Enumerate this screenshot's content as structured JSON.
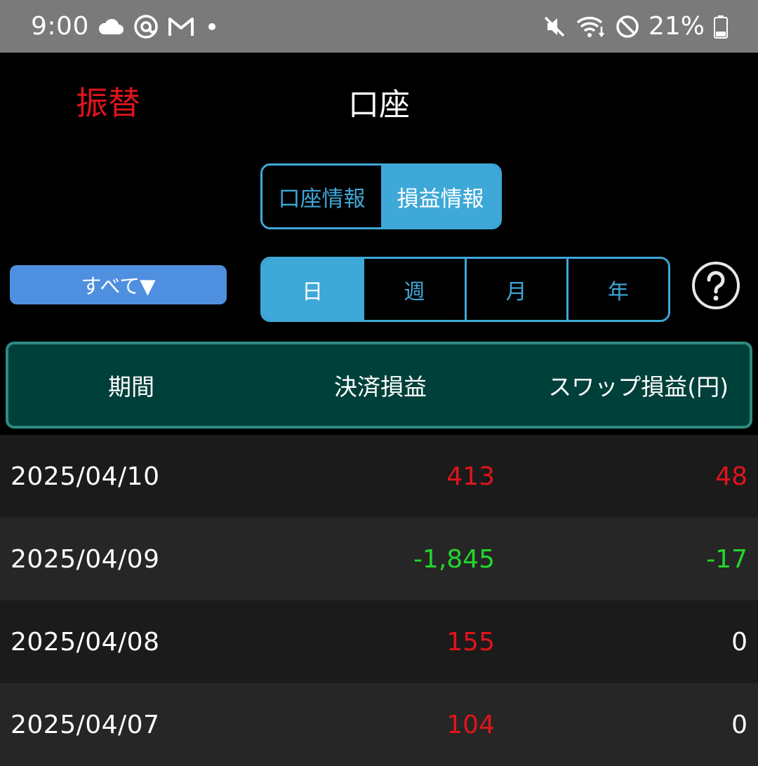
{
  "status_bar": {
    "time": "9:00",
    "battery": "21%",
    "icons_left": [
      "cloud-icon",
      "threads-icon",
      "gmail-icon",
      "dot-icon"
    ],
    "icons_right": [
      "mute-icon",
      "wifi-icon",
      "do-not-disturb-icon",
      "battery-icon"
    ]
  },
  "header": {
    "transfer_label": "振替",
    "title": "口座"
  },
  "info_tabs": [
    {
      "label": "口座情報",
      "active": false
    },
    {
      "label": "損益情報",
      "active": true
    }
  ],
  "filter": {
    "label": "すべて▼"
  },
  "period_tabs": [
    {
      "label": "日",
      "active": true
    },
    {
      "label": "週",
      "active": false
    },
    {
      "label": "月",
      "active": false
    },
    {
      "label": "年",
      "active": false
    }
  ],
  "table": {
    "headers": {
      "period": "期間",
      "settlement": "決済損益",
      "swap": "スワップ損益(円)"
    },
    "rows": [
      {
        "date": "2025/04/10",
        "settlement": "413",
        "swap": "48"
      },
      {
        "date": "2025/04/09",
        "settlement": "-1,845",
        "swap": "-17"
      },
      {
        "date": "2025/04/08",
        "settlement": "155",
        "swap": "0"
      },
      {
        "date": "2025/04/07",
        "settlement": "104",
        "swap": "0"
      }
    ]
  },
  "colors": {
    "accent_blue": "#3ea8d8",
    "filter_blue": "#4f8fe0",
    "profit_red": "#e0141b",
    "loss_green": "#22d62a",
    "header_teal": "#00403a"
  }
}
